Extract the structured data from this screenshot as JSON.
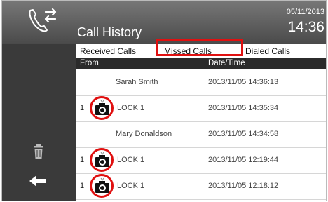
{
  "header": {
    "title": "Call History",
    "date": "05/11/2013",
    "time": "14:36"
  },
  "tabs": [
    {
      "label": "Received Calls"
    },
    {
      "label": "Missed Calls"
    },
    {
      "label": "Dialed Calls"
    }
  ],
  "columns": {
    "from": "From",
    "datetime": "Date/Time"
  },
  "rows": [
    {
      "count": "",
      "name": "Sarah Smith",
      "datetime": "2013/11/05 14:36:13"
    },
    {
      "count": "1",
      "name": "LOCK 1",
      "datetime": "2013/11/05 14:35:34"
    },
    {
      "count": "",
      "name": "Mary Donaldson",
      "datetime": "2013/11/05 14:34:58"
    },
    {
      "count": "1",
      "name": "LOCK 1",
      "datetime": "2013/11/05 12:19:44"
    },
    {
      "count": "1",
      "name": "LOCK 1",
      "datetime": "2013/11/05 12:18:12"
    }
  ],
  "icons": {
    "phone": "phone-transfer-icon",
    "trash": "trash-icon",
    "back": "back-arrow-icon",
    "camera": "camera-icon"
  },
  "colors": {
    "highlight": "#e01010",
    "header": "#555555",
    "sidebar": "#3a3a3a"
  }
}
